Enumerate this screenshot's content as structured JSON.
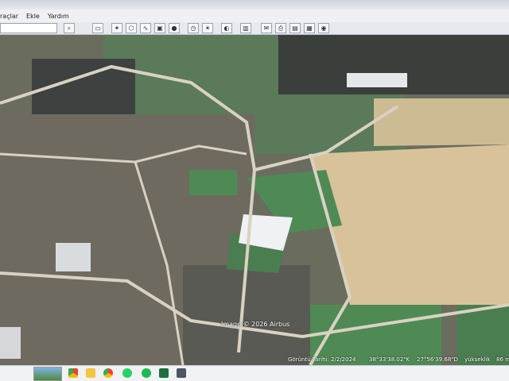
{
  "menu": {
    "items": [
      "raçlar",
      "Ekle",
      "Yardım"
    ]
  },
  "toolbar": {
    "buttons": [
      "search-icon",
      "sidebar-icon",
      "placemark-icon",
      "polygon-icon",
      "path-icon",
      "overlay-icon",
      "tour-icon",
      "history-icon",
      "sun-icon",
      "planets-icon",
      "ruler-icon",
      "email-icon",
      "print-icon",
      "save-image-icon",
      "maps-icon",
      "web-icon"
    ]
  },
  "map": {
    "copyright": "Image © 2026 Airbus"
  },
  "status": {
    "date": "Görüntü Tarihi: 2/2/2024",
    "lat": "38°33'38.02\"K",
    "lon": "27°56'39.68\"D",
    "elev": "yükseklik",
    "eye": "86 m"
  },
  "taskbar": {
    "apps": [
      "chrome-icon",
      "files-icon",
      "store-icon",
      "whatsapp-icon",
      "spotify-icon",
      "excel-icon",
      "terminal-icon"
    ]
  },
  "colors": {
    "field": "#d8c29a",
    "grass": "#4f8a55",
    "village": "#6f6a5f",
    "road": "#d9d2c3"
  }
}
